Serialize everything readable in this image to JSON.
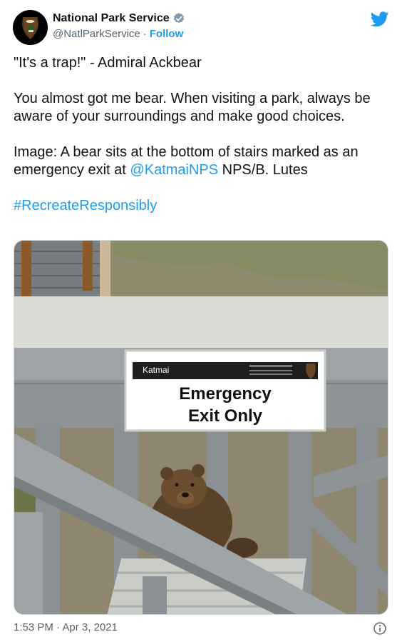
{
  "account": {
    "display_name": "National Park Service",
    "handle": "@NatlParkService",
    "separator": "·",
    "follow_label": "Follow"
  },
  "tweet": {
    "line1": "\"It's a trap!\" - Admiral Ackbear",
    "line2": "You almost got me bear. When visiting a park, always be aware of your surroundings and make good choices.",
    "line3_prefix": "Image: A bear sits at the bottom of stairs marked as an emergency exit at ",
    "line3_mention": "@KatmaiNPS",
    "line3_suffix": " NPS/B. Lutes",
    "hashtag": "#RecreateResponsibly"
  },
  "sign": {
    "header": "Katmai",
    "line1": "Emergency",
    "line2": "Exit Only"
  },
  "footer": {
    "time": "1:53 PM",
    "separator": "·",
    "date": "Apr 3, 2021"
  },
  "colors": {
    "link": "#1d9bf0",
    "text": "#0f1419",
    "muted": "#536471"
  },
  "icons": [
    "nps-arrowhead-icon",
    "verified-badge-icon",
    "twitter-bird-icon",
    "info-icon"
  ]
}
